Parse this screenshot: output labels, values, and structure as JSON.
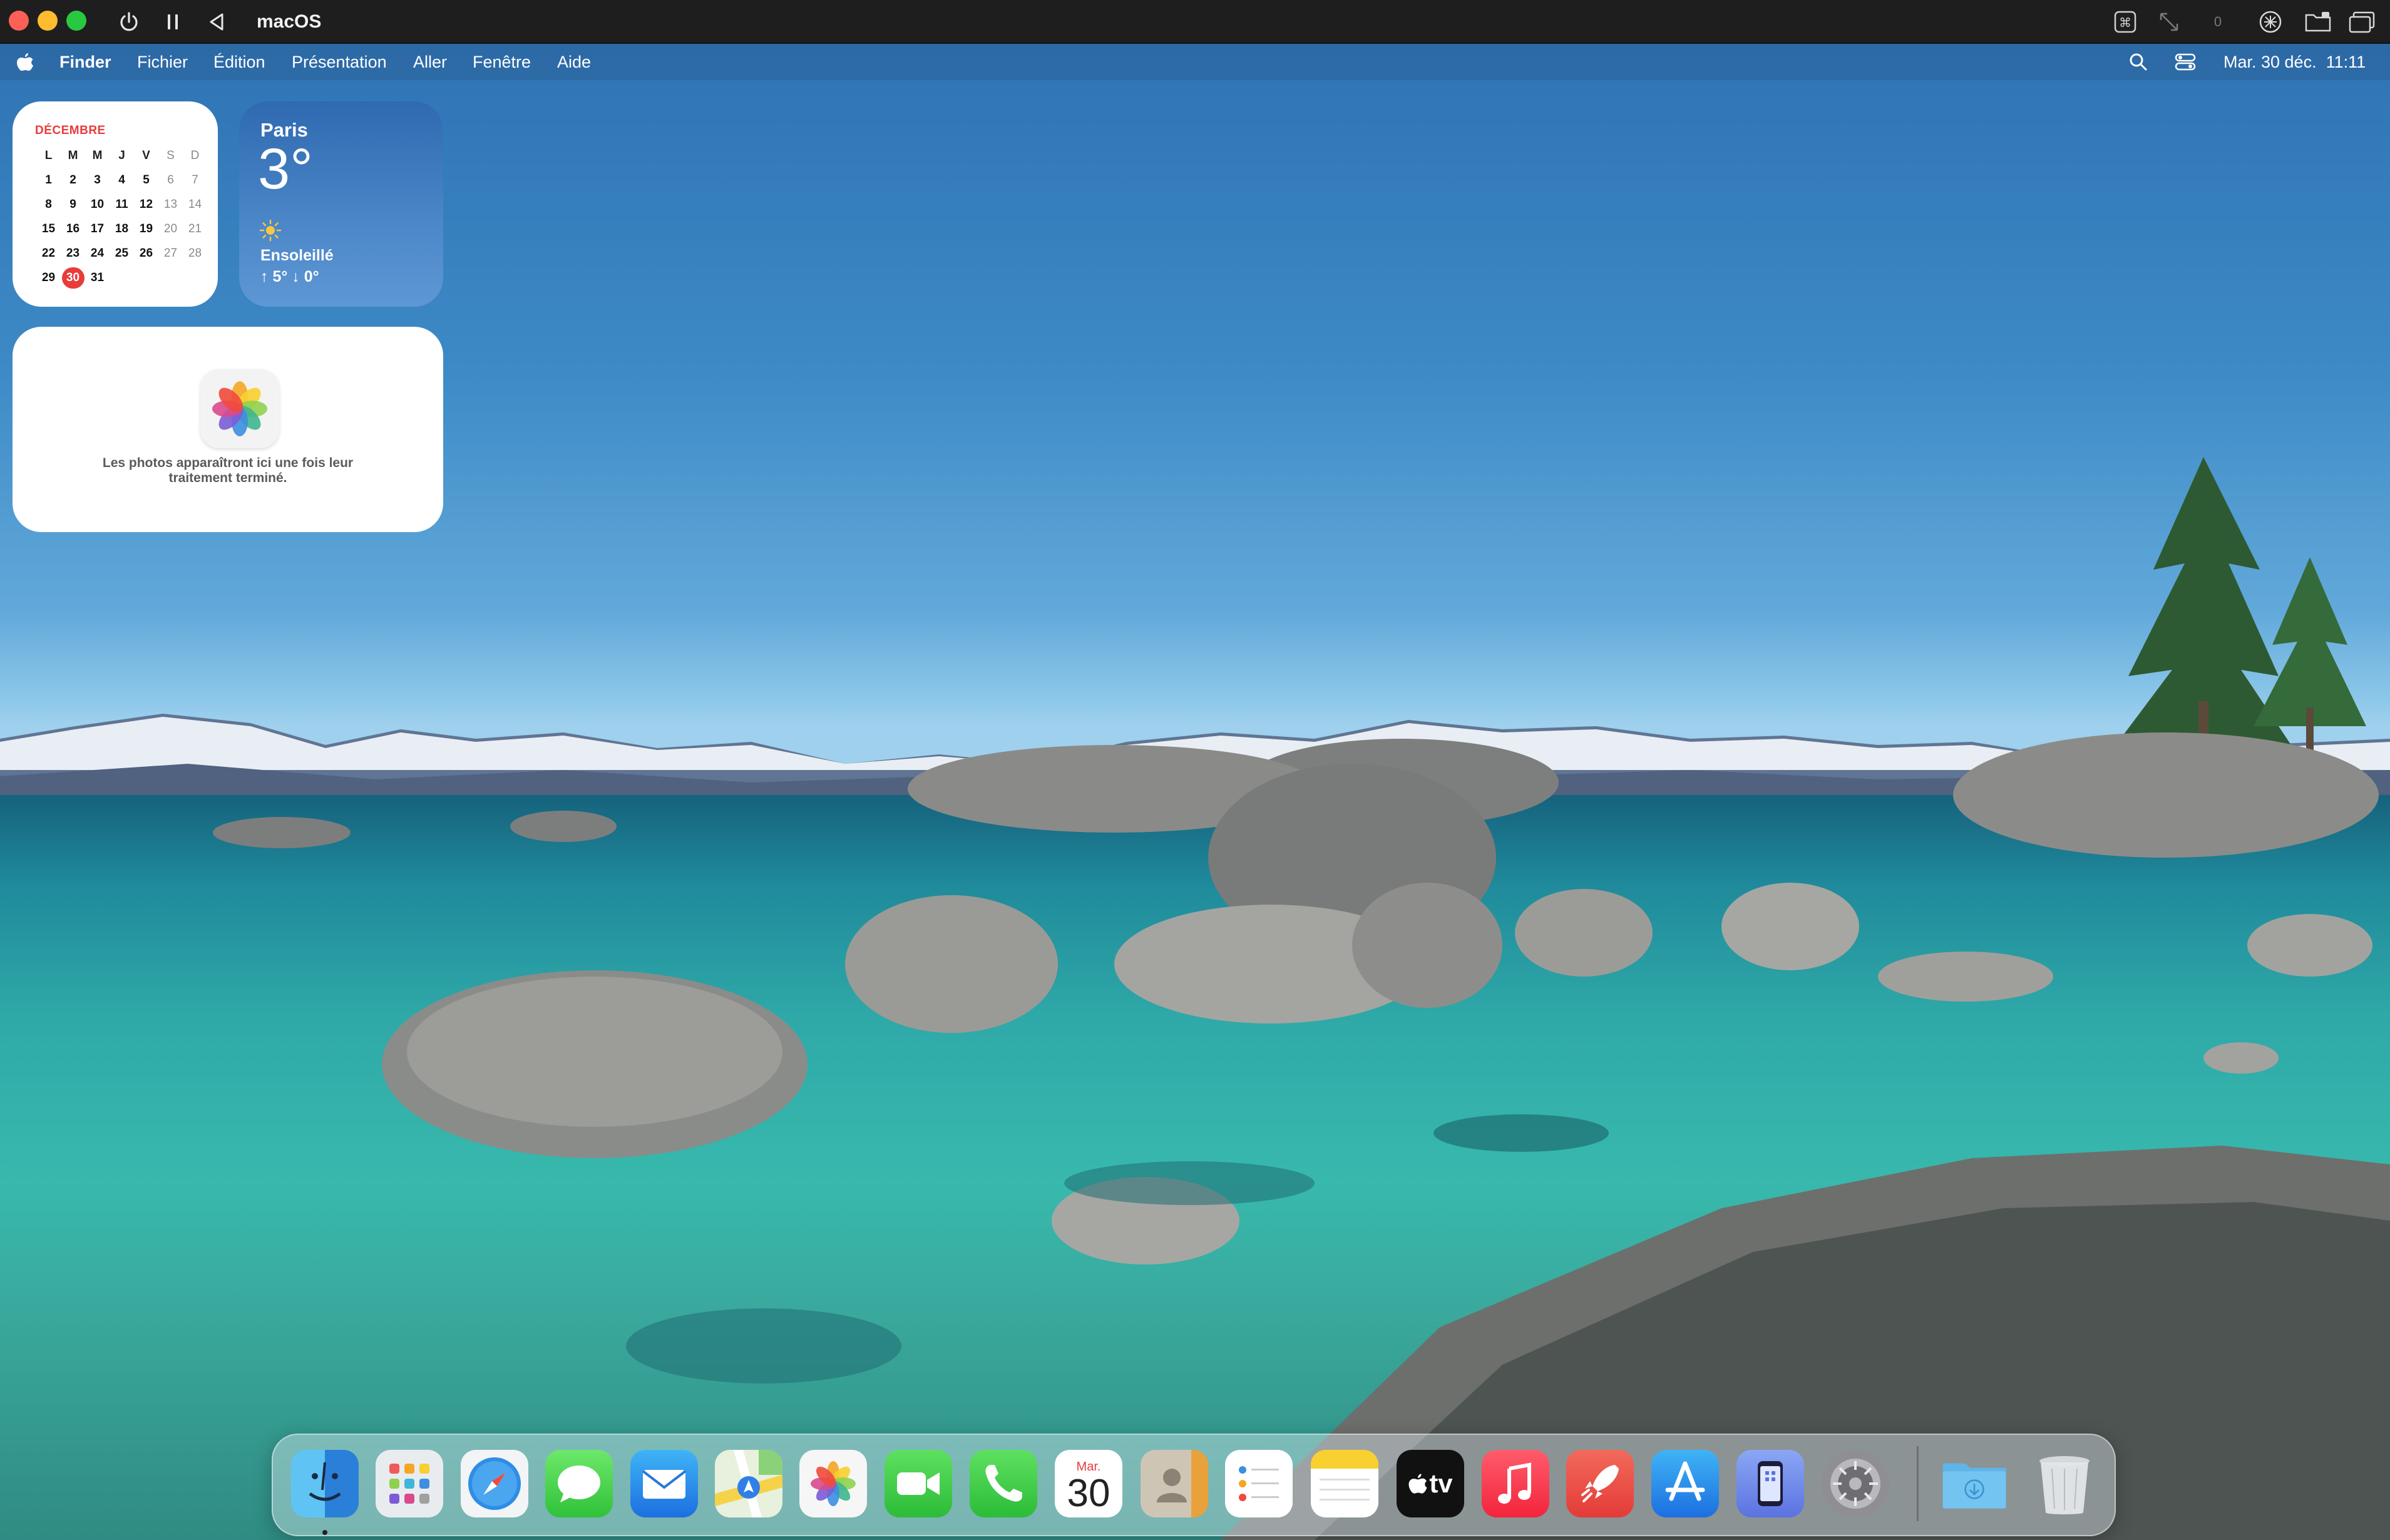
{
  "vm_toolbar": {
    "title": "macOS",
    "traffic_colors": [
      "#fe5f57",
      "#febc2e",
      "#28c840"
    ],
    "left_icons": [
      "power-icon",
      "pause-icon",
      "back-icon"
    ],
    "right_icons": [
      "keyboard-command-icon",
      "resize-arrows-icon",
      "usb-icon",
      "screen-share-icon",
      "folder-share-icon",
      "windows-icon"
    ],
    "usb_label": "0"
  },
  "menubar": {
    "apple_icon": "apple-icon",
    "items": [
      "Finder",
      "Fichier",
      "Édition",
      "Présentation",
      "Aller",
      "Fenêtre",
      "Aide"
    ],
    "status_icons": [
      "search-icon",
      "control-center-icon"
    ],
    "clock": "Mar. 30 déc.  11:11"
  },
  "calendar_widget": {
    "month": "DÉCEMBRE",
    "weekdays": [
      "L",
      "M",
      "M",
      "J",
      "V",
      "S",
      "D"
    ],
    "days": [
      [
        "1",
        "2",
        "3",
        "4",
        "5",
        "6",
        "7"
      ],
      [
        "8",
        "9",
        "10",
        "11",
        "12",
        "13",
        "14"
      ],
      [
        "15",
        "16",
        "17",
        "18",
        "19",
        "20",
        "21"
      ],
      [
        "22",
        "23",
        "24",
        "25",
        "26",
        "27",
        "28"
      ],
      [
        "29",
        "30",
        "31",
        "",
        "",
        "",
        ""
      ]
    ],
    "today": "30",
    "accent": "#e83b3b"
  },
  "weather_widget": {
    "city": "Paris",
    "temperature": "3°",
    "condition_icon": "sun-icon",
    "condition": "Ensoleillé",
    "range": "↑ 5° ↓ 0°"
  },
  "photos_widget": {
    "icon": "photos-icon",
    "message_line1": "Les photos apparaîtront ici une fois leur",
    "message_line2": "traitement terminé."
  },
  "dock": {
    "apps": [
      "Finder",
      "Launchpad",
      "Safari",
      "Messages",
      "Mail",
      "Plans",
      "Photos",
      "FaceTime",
      "Téléphone",
      "Calendrier",
      "Contacts",
      "Rappels",
      "Notes",
      "TV",
      "Musique",
      "Rocket",
      "App Store",
      "iPhone Mirroring",
      "Réglages Système",
      "Téléchargements",
      "Corbeille"
    ],
    "calendar_icon_month": "Mar.",
    "calendar_icon_day": "30",
    "tv_label": "tv"
  }
}
